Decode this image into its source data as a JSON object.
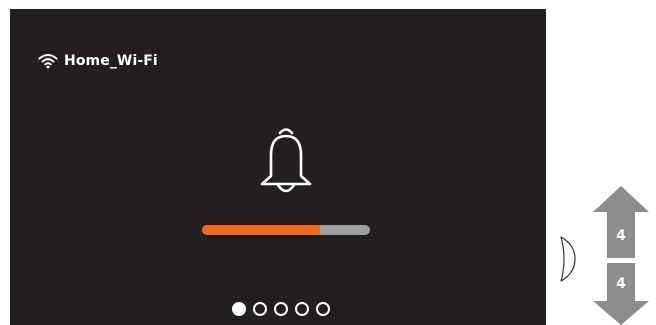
{
  "status_bar": {
    "wifi_icon": "wifi-icon",
    "network_name": "Home_Wi-Fi"
  },
  "main": {
    "icon": "bell-icon",
    "volume": {
      "level": 0.7,
      "fill_color": "#f26a1f",
      "track_color": "#9e9e9e"
    },
    "pagination": {
      "total": 5,
      "active_index": 0
    }
  },
  "controls": {
    "knob_icon": "side-knob-icon",
    "up": {
      "icon": "arrow-up-icon",
      "label": "4"
    },
    "down": {
      "icon": "arrow-down-icon",
      "label": "4"
    }
  },
  "colors": {
    "screen_background": "#231f20",
    "text": "#ffffff",
    "arrow_gray": "#8c8c8c"
  }
}
